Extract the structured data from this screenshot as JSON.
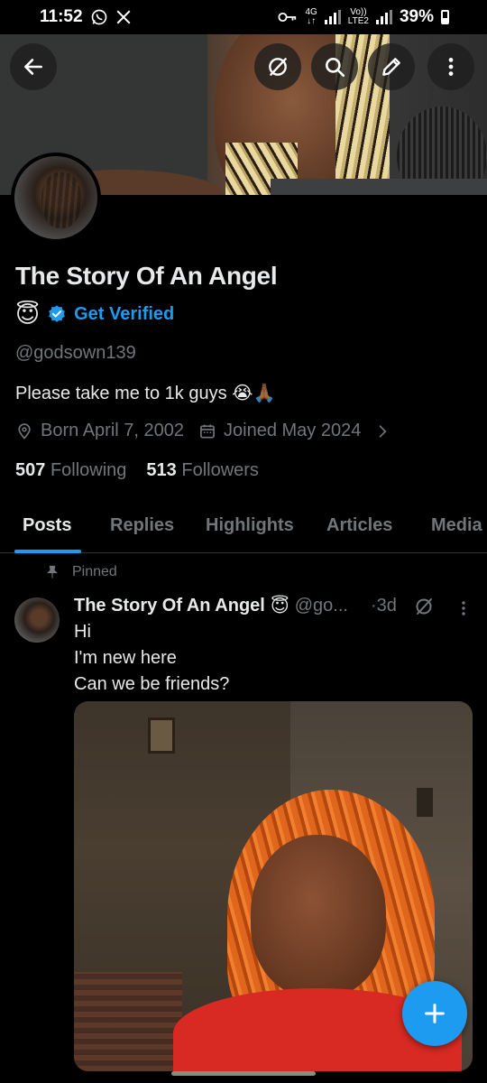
{
  "status_bar": {
    "time": "11:52",
    "network_top": "4G",
    "network_volte": "Vo))",
    "network_lte": "LTE2",
    "battery": "39%"
  },
  "header": {
    "back_icon": "arrow-left-icon",
    "grok_icon": "grok-icon",
    "search_icon": "search-icon",
    "edit_icon": "pencil-icon",
    "more_icon": "more-vertical-icon"
  },
  "profile": {
    "display_name": "The Story Of An Angel",
    "name_emoji": "😇",
    "get_verified": "Get Verified",
    "handle": "@godsown139",
    "bio": "Please take me to 1k guys 😭🙏🏾",
    "born": "Born April 7, 2002",
    "joined": "Joined May 2024",
    "following_count": "507",
    "following_label": "Following",
    "followers_count": "513",
    "followers_label": "Followers"
  },
  "tabs": [
    {
      "label": "Posts",
      "active": true
    },
    {
      "label": "Replies",
      "active": false
    },
    {
      "label": "Highlights",
      "active": false
    },
    {
      "label": "Articles",
      "active": false
    },
    {
      "label": "Media",
      "active": false
    }
  ],
  "pinned_post": {
    "pinned_label": "Pinned",
    "author": "The Story Of An Angel",
    "author_emoji": "😇",
    "handle": "@go...",
    "time": "·3d",
    "lines": [
      "Hi",
      "I'm new here",
      "Can we be friends?"
    ]
  },
  "colors": {
    "accent": "#1d9bf0",
    "background": "#000000",
    "text_primary": "#e7e9ea",
    "text_secondary": "#71767b"
  }
}
